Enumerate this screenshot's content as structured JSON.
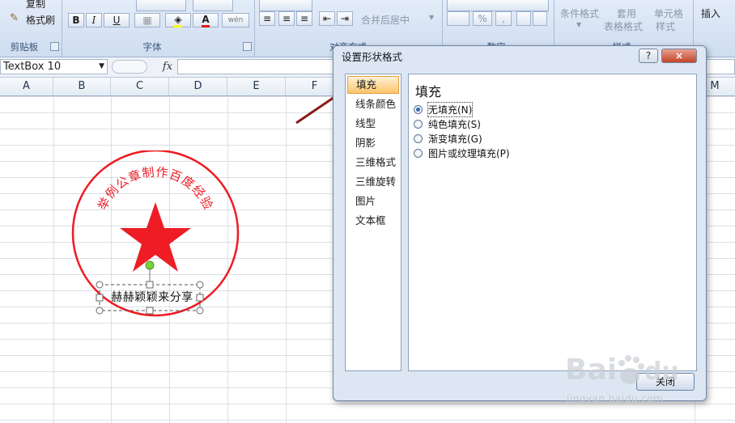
{
  "ribbon": {
    "copy_label": "复制",
    "format_painter_label": "格式刷",
    "clipboard_group": "剪贴板",
    "font_group": "字体",
    "alignment_group": "对齐方式",
    "number_group": "数字",
    "styles_group": "样式",
    "bold": "B",
    "italic": "I",
    "underline": "U",
    "font_color_letter": "A",
    "wen_label": "wén",
    "merge_center": "合并后居中",
    "percent": "%",
    "comma": ",",
    "conditional_format": "条件格式",
    "apply": "套用",
    "table_format": "表格格式",
    "cell": "单元格",
    "cell_style": "样式",
    "insert": "插入"
  },
  "formula_bar": {
    "name_box": "TextBox 10",
    "fx": "fx",
    "value": ""
  },
  "columns": [
    "A",
    "B",
    "C",
    "D",
    "E",
    "F",
    "M"
  ],
  "seal": {
    "arc_text": "举例公章制作百度经验",
    "textbox_text": "赫赫颖颖来分享",
    "color": "#ee1c24"
  },
  "dialog": {
    "title": "设置形状格式",
    "help": "?",
    "close_x": "×",
    "nav_items": [
      "填充",
      "线条颜色",
      "线型",
      "阴影",
      "三维格式",
      "三维旋转",
      "图片",
      "文本框"
    ],
    "selected_nav": "填充",
    "panel_heading": "填充",
    "fill_options": [
      {
        "label": "无填充(N)",
        "checked": true
      },
      {
        "label": "纯色填充(S)",
        "checked": false
      },
      {
        "label": "渐变填充(G)",
        "checked": false
      },
      {
        "label": "图片或纹理填充(P)",
        "checked": false
      }
    ],
    "close_button": "关闭"
  },
  "watermark": {
    "text": "jingyan.baidu.com"
  },
  "colors": {
    "annotation_arrow": "#8b1a1a",
    "selected_nav_bg": "#fbc56a"
  }
}
